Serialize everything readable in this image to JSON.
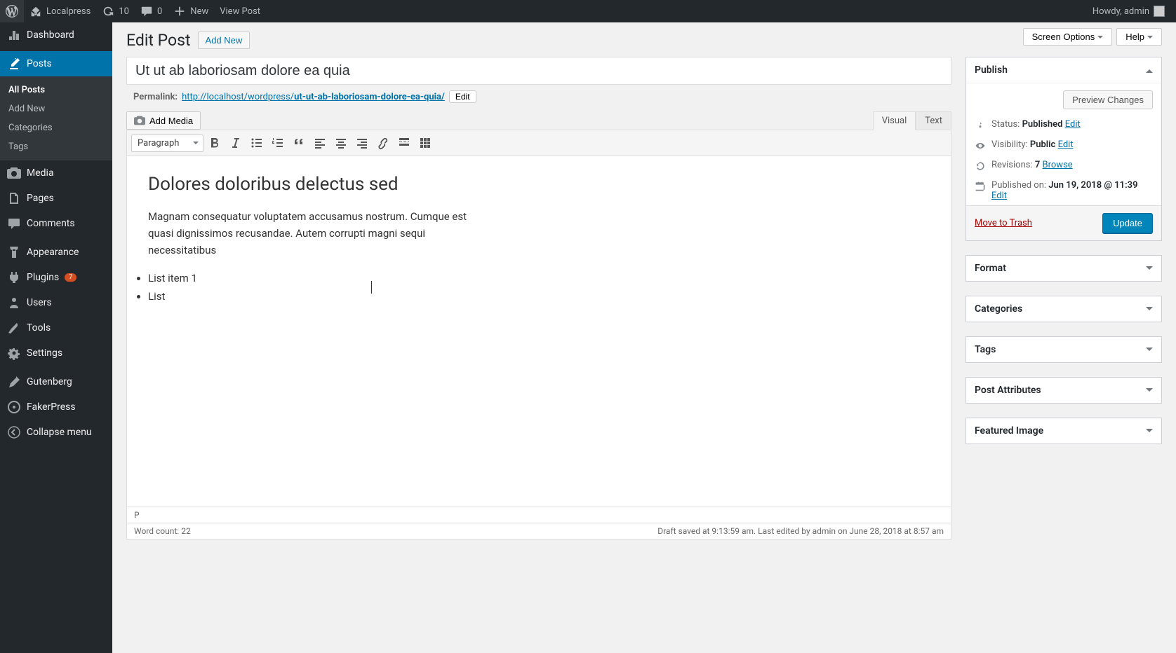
{
  "adminbar": {
    "site": "Localpress",
    "updates": "10",
    "comments": "0",
    "new": "New",
    "view_post": "View Post",
    "howdy": "Howdy, admin"
  },
  "sidebar": {
    "dashboard": "Dashboard",
    "posts": "Posts",
    "posts_sub": {
      "all": "All Posts",
      "add_new": "Add New",
      "categories": "Categories",
      "tags": "Tags"
    },
    "media": "Media",
    "pages": "Pages",
    "comments": "Comments",
    "appearance": "Appearance",
    "plugins": "Plugins",
    "plugins_badge": "7",
    "users": "Users",
    "tools": "Tools",
    "settings": "Settings",
    "gutenberg": "Gutenberg",
    "fakerpress": "FakerPress",
    "collapse": "Collapse menu"
  },
  "top_options": {
    "screen_options": "Screen Options",
    "help": "Help"
  },
  "page": {
    "title": "Edit Post",
    "add_new": "Add New",
    "post_title": "Ut ut ab laboriosam dolore ea quia",
    "permalink_label": "Permalink:",
    "permalink_base": "http://localhost/wordpress/",
    "permalink_slug": "ut-ut-ab-laboriosam-dolore-ea-quia/",
    "edit_btn": "Edit"
  },
  "editor": {
    "add_media": "Add Media",
    "tab_visual": "Visual",
    "tab_text": "Text",
    "format_dropdown": "Paragraph",
    "content_h2": "Dolores doloribus delectus sed",
    "content_p": "Magnam consequatur voluptatem accusamus nostrum. Cumque est quasi dignissimos recusandae. Autem corrupti magni sequi necessitatibus",
    "list_item_1": "List item 1",
    "list_item_2": "List",
    "status_path": "P",
    "word_count_label": "Word count:",
    "word_count": "22",
    "autosave": "Draft saved at 9:13:59 am. Last edited by admin on June 28, 2018 at 8:57 am"
  },
  "publish": {
    "title": "Publish",
    "preview": "Preview Changes",
    "status_label": "Status:",
    "status_value": "Published",
    "visibility_label": "Visibility:",
    "visibility_value": "Public",
    "revisions_label": "Revisions:",
    "revisions_value": "7",
    "browse": "Browse",
    "published_label": "Published on:",
    "published_value": "Jun 19, 2018 @ 11:39",
    "edit_link": "Edit",
    "trash": "Move to Trash",
    "update": "Update"
  },
  "metaboxes": {
    "format": "Format",
    "categories": "Categories",
    "tags": "Tags",
    "post_attributes": "Post Attributes",
    "featured_image": "Featured Image"
  }
}
